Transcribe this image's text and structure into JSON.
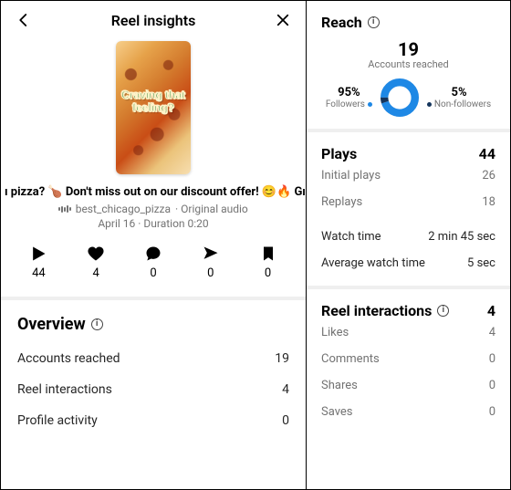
{
  "header": {
    "title": "Reel insights"
  },
  "thumb": {
    "overlay": "Craving that feeling?"
  },
  "caption": "ı pizza? 🍗 Don't miss out on our discount offer! 😊🔥  Gı",
  "audio": {
    "account": "best_chicago_pizza",
    "suffix": " · Original audio"
  },
  "meta": {
    "date": "April 16",
    "duration": "Duration 0:20"
  },
  "stats": {
    "plays": "44",
    "likes": "4",
    "comments": "0",
    "shares": "0",
    "saves": "0"
  },
  "overview": {
    "title": "Overview",
    "rows": {
      "accounts_reached": {
        "label": "Accounts reached",
        "value": "19"
      },
      "reel_interactions": {
        "label": "Reel interactions",
        "value": "4"
      },
      "profile_activity": {
        "label": "Profile activity",
        "value": "0"
      }
    }
  },
  "reach": {
    "title": "Reach",
    "value": "19",
    "sub": "Accounts reached",
    "followers_pct": "95%",
    "followers_label": "Followers",
    "nonfollowers_pct": "5%",
    "nonfollowers_label": "Non-followers"
  },
  "plays": {
    "title": "Plays",
    "total": "44",
    "initial": {
      "label": "Initial plays",
      "value": "26"
    },
    "replays": {
      "label": "Replays",
      "value": "18"
    },
    "watch_time": {
      "label": "Watch time",
      "value": "2 min 45 sec"
    },
    "avg_watch": {
      "label": "Average watch time",
      "value": "5 sec"
    }
  },
  "interactions": {
    "title": "Reel interactions",
    "total": "4",
    "likes": {
      "label": "Likes",
      "value": "4"
    },
    "comments": {
      "label": "Comments",
      "value": "0"
    },
    "shares": {
      "label": "Shares",
      "value": "0"
    },
    "saves": {
      "label": "Saves",
      "value": "0"
    }
  },
  "chart_data": {
    "type": "pie",
    "title": "Accounts reached",
    "series": [
      {
        "name": "Followers",
        "value": 95,
        "color": "#1e88e5"
      },
      {
        "name": "Non-followers",
        "value": 5,
        "color": "#15355c"
      }
    ],
    "center_value": 19
  }
}
